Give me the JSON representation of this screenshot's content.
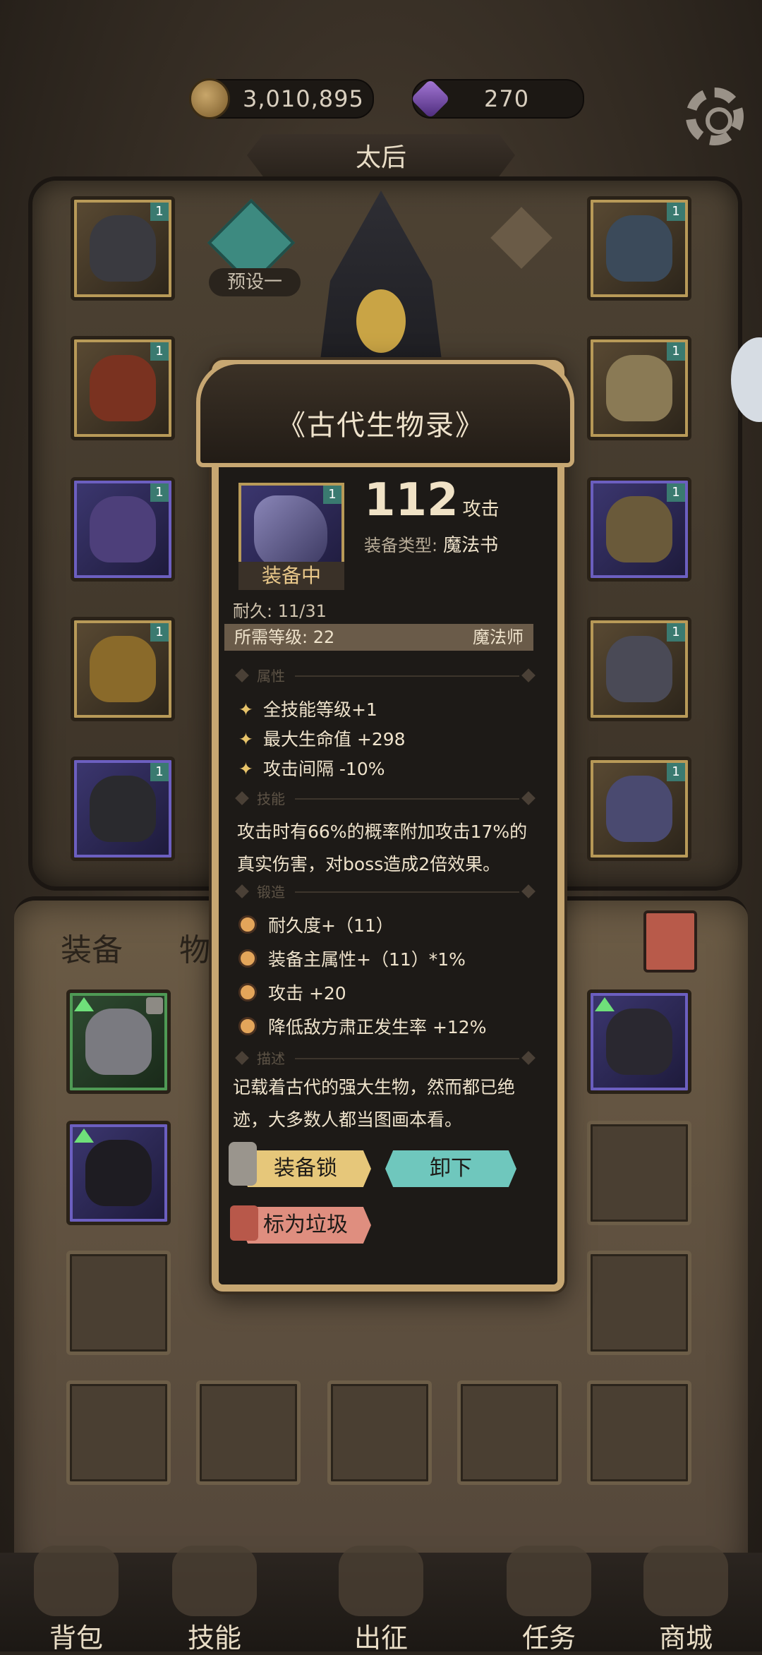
{
  "header": {
    "gold": "3,010,895",
    "gems": "270",
    "character_name": "太后",
    "preset_label": "预设一"
  },
  "tabs": {
    "equipment": "装备",
    "items": "物品"
  },
  "tooltip": {
    "title": "《古代生物录》",
    "attack_value": "112",
    "attack_label": "攻击",
    "type_label": "装备类型:",
    "type_value": "魔法书",
    "equipped_label": "装备中",
    "slot_tag": "1",
    "durability": "耐久: 11/31",
    "required_level": "所需等级: 22",
    "class": "魔法师",
    "sections": {
      "attributes": "属性",
      "skill": "技能",
      "forge": "锻造",
      "description": "描述"
    },
    "attributes": [
      "全技能等级+1",
      "最大生命值 +298",
      "攻击间隔 -10%"
    ],
    "skill_text": "攻击时有66%的概率附加攻击17%的真实伤害，对boss造成2倍效果。",
    "forge": [
      "耐久度+（11）",
      "装备主属性+（11）*1%",
      "攻击 +20",
      "降低敌方肃正发生率 +12%"
    ],
    "description_text": "记载着古代的强大生物，然而都已绝迹，大多数人都当图画本看。",
    "buttons": {
      "lock": "装备锁",
      "unequip": "卸下",
      "mark_junk": "标为垃圾"
    }
  },
  "nav": [
    {
      "label": "背包"
    },
    {
      "label": "技能"
    },
    {
      "label": "出征"
    },
    {
      "label": "任务"
    },
    {
      "label": "商城"
    }
  ],
  "slot_tags": "1",
  "colors": {
    "gold_frame": "#c7a772",
    "unequip_btn": "#6fc7bd",
    "lock_btn": "#e6c77a",
    "junk_btn": "#df8e7f"
  }
}
